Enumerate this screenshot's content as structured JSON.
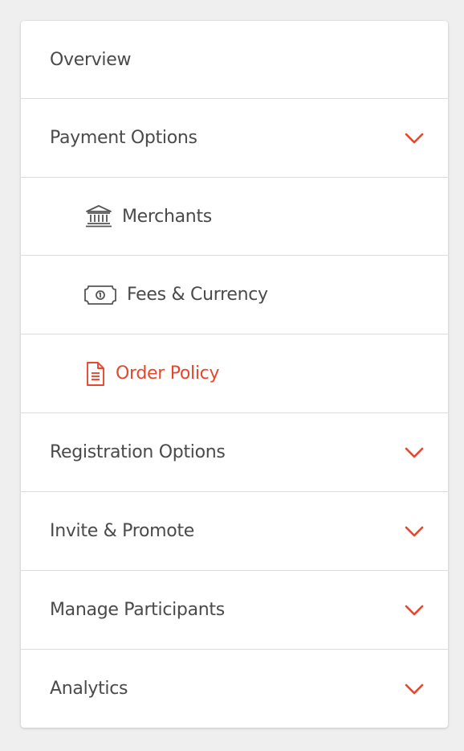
{
  "colors": {
    "accent": "#e8472d",
    "text": "#4a4a4a",
    "icon": "#555555",
    "divider": "#dcdcdc",
    "background": "#efefef"
  },
  "menu": {
    "overview": {
      "label": "Overview"
    },
    "payment_options": {
      "label": "Payment Options",
      "expanded": true,
      "icon": "chevron-down-icon"
    },
    "payment_sub": [
      {
        "label": "Merchants",
        "icon": "bank-icon",
        "active": false
      },
      {
        "label": "Fees & Currency",
        "icon": "banknote-icon",
        "active": false
      },
      {
        "label": "Order Policy",
        "icon": "document-icon",
        "active": true
      }
    ],
    "registration_options": {
      "label": "Registration Options",
      "icon": "chevron-down-icon"
    },
    "invite_promote": {
      "label": "Invite & Promote",
      "icon": "chevron-down-icon"
    },
    "manage_participants": {
      "label": "Manage Participants",
      "icon": "chevron-down-icon"
    },
    "analytics": {
      "label": "Analytics",
      "icon": "chevron-down-icon"
    }
  }
}
